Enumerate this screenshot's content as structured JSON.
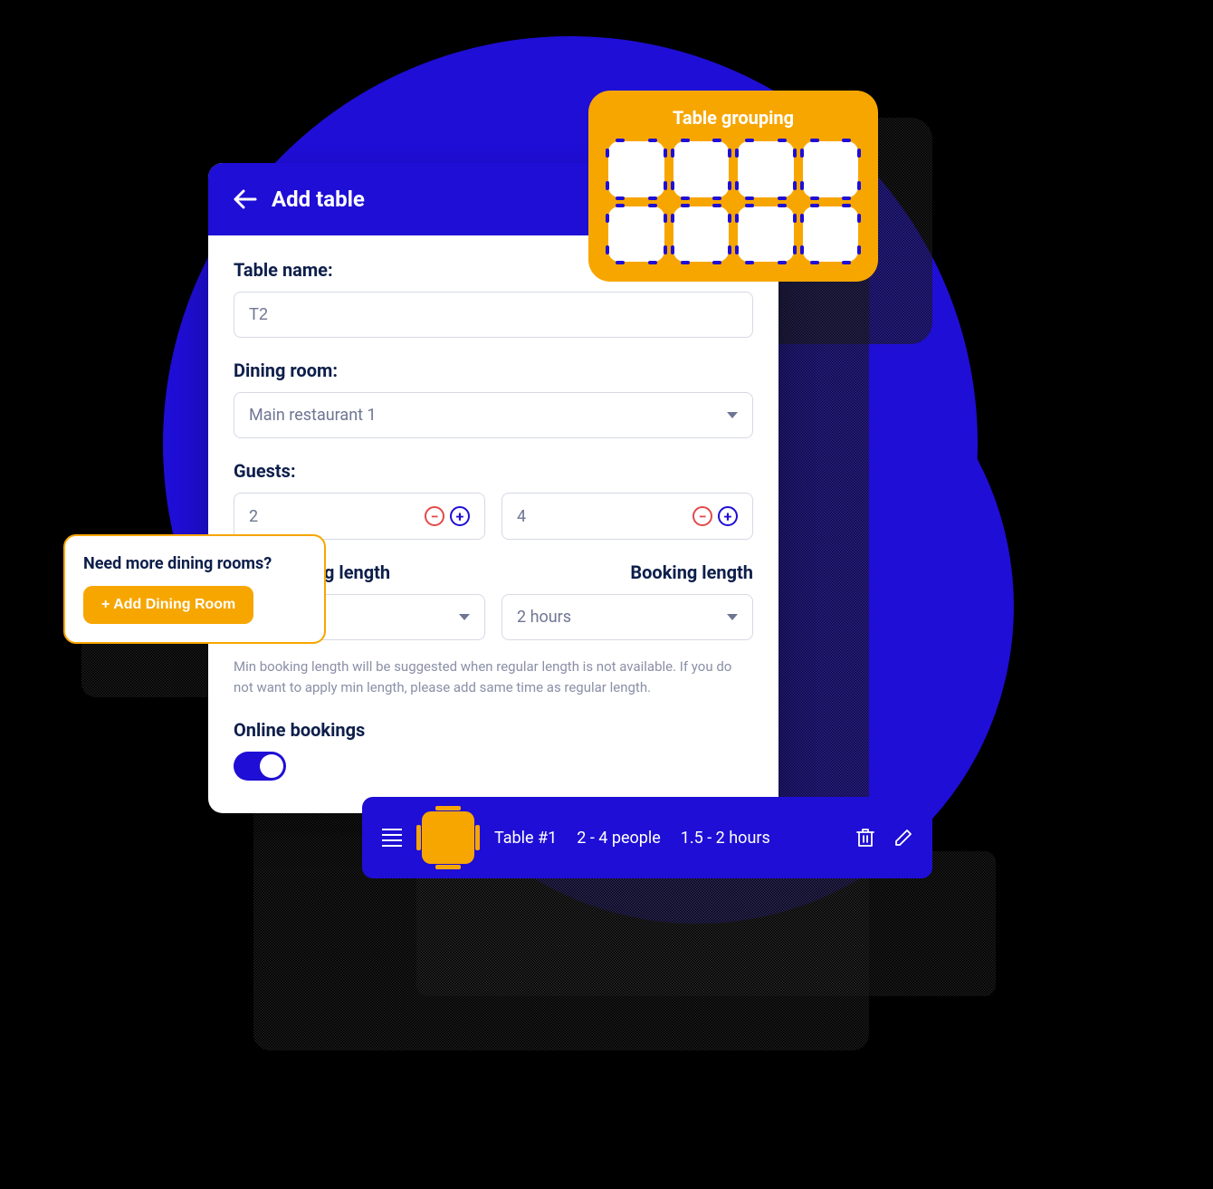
{
  "main": {
    "title": "Add table",
    "table_name_label": "Table name:",
    "table_name_value": "T2",
    "dining_room_label": "Dining room:",
    "dining_room_value": "Main restaurant 1",
    "guests_label": "Guests:",
    "guests_min": "2",
    "guests_max": "4",
    "min_booking_label": "Min booking length",
    "min_booking_value": "",
    "booking_label": "Booking length",
    "booking_value": "2 hours",
    "helper": "Min booking length will be suggested when regular length is not available. If you do not want to apply min length, please add same time as regular length.",
    "online_bookings_label": "Online bookings",
    "online_bookings_on": true
  },
  "grouping": {
    "title": "Table grouping"
  },
  "need_rooms": {
    "title": "Need more dining rooms?",
    "button": "+ Add Dining Room"
  },
  "summary": {
    "name": "Table #1",
    "people": "2 - 4 people",
    "duration": "1.5 - 2 hours"
  }
}
